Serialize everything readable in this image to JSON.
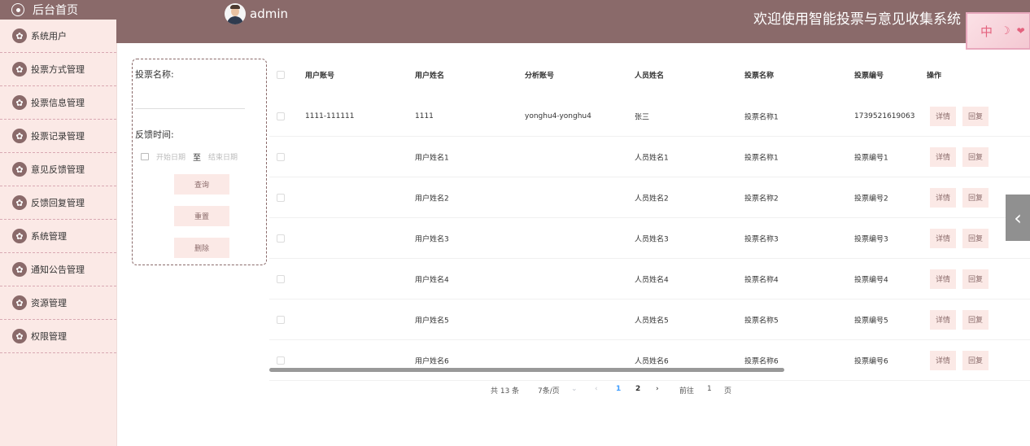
{
  "sidebar": {
    "home_label": "后台首页",
    "items": [
      {
        "label": "系统用户"
      },
      {
        "label": "投票方式管理"
      },
      {
        "label": "投票信息管理"
      },
      {
        "label": "投票记录管理"
      },
      {
        "label": "意见反馈管理"
      },
      {
        "label": "反馈回复管理"
      },
      {
        "label": "系统管理"
      },
      {
        "label": "通知公告管理"
      },
      {
        "label": "资源管理"
      },
      {
        "label": "权限管理"
      }
    ]
  },
  "header": {
    "user": "admin",
    "welcome": "欢迎使用智能投票与意见收集系统",
    "lang_badge": "中"
  },
  "search": {
    "name_label": "投票名称:",
    "name_value": "",
    "time_label": "反馈时间:",
    "start_placeholder": "开始日期",
    "to": "至",
    "end_placeholder": "结束日期",
    "query_button": "查询",
    "reset_button": "重置",
    "delete_button": "删除"
  },
  "table": {
    "headers": [
      "用户账号",
      "用户姓名",
      "分析账号",
      "人员姓名",
      "投票名称",
      "投票编号",
      "操作"
    ],
    "rows": [
      [
        "1111-111111",
        "1111",
        "yonghu4-yonghu4",
        "张三",
        "投票名称1",
        "1739521619063"
      ],
      [
        "",
        "用户姓名1",
        "",
        "人员姓名1",
        "投票名称1",
        "投票编号1"
      ],
      [
        "",
        "用户姓名2",
        "",
        "人员姓名2",
        "投票名称2",
        "投票编号2"
      ],
      [
        "",
        "用户姓名3",
        "",
        "人员姓名3",
        "投票名称3",
        "投票编号3"
      ],
      [
        "",
        "用户姓名4",
        "",
        "人员姓名4",
        "投票名称4",
        "投票编号4"
      ],
      [
        "",
        "用户姓名5",
        "",
        "人员姓名5",
        "投票名称5",
        "投票编号5"
      ],
      [
        "",
        "用户姓名6",
        "",
        "人员姓名6",
        "投票名称6",
        "投票编号6"
      ]
    ],
    "detail_label": "详情",
    "reply_label": "回复"
  },
  "pagination": {
    "total": "共 13 条",
    "page_size": "7条/页",
    "pages": [
      "1",
      "2"
    ],
    "current": "1",
    "goto_label": "前往",
    "goto_value": "1",
    "page_unit": "页"
  },
  "colors": {
    "primary": "#8a6a6a",
    "light": "#fbe9e6",
    "active_page": "#409eff"
  }
}
